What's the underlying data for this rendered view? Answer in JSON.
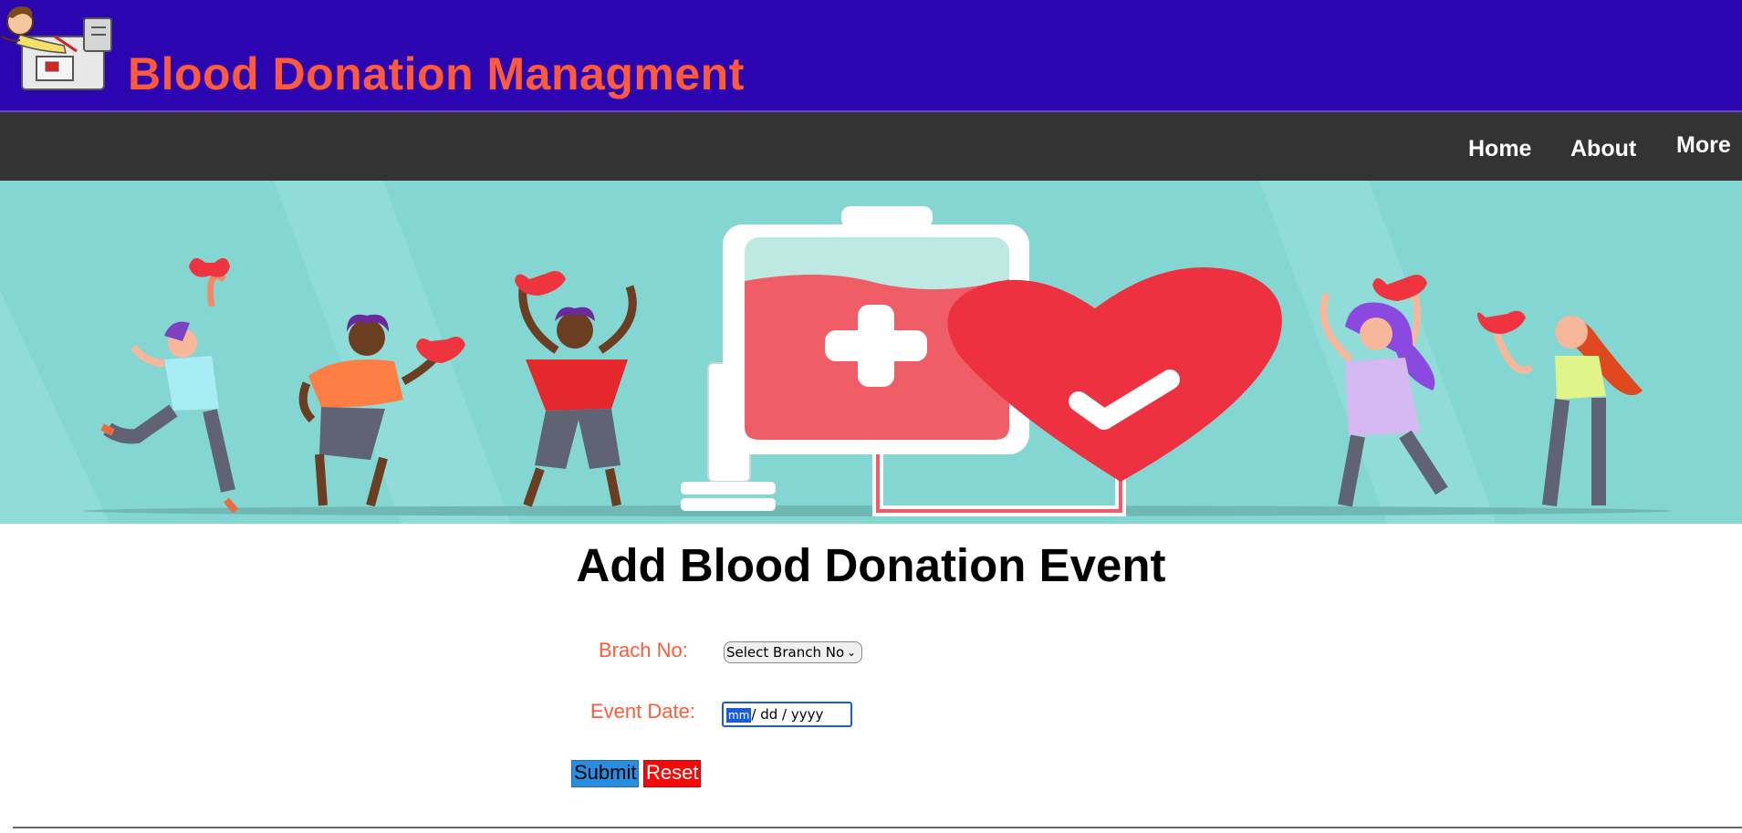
{
  "header": {
    "title": "Blood Donation Managment",
    "logo_icon": "blood-donor-cartoon-logo",
    "bg_color": "#2a05b0",
    "title_color": "#ff5a3c"
  },
  "nav": {
    "items": [
      {
        "label": "Home"
      },
      {
        "label": "About"
      },
      {
        "label": "More"
      }
    ]
  },
  "banner": {
    "illustration": "people-holding-hearts-blood-bag-syringe"
  },
  "form": {
    "title": "Add Blood Donation Event",
    "branch_label": "Brach No:",
    "branch_select_value": "Select Branch No",
    "date_label": "Event Date:",
    "date_month_placeholder": "mm",
    "date_rest_placeholder": "/ dd / yyyy",
    "submit_label": "Submit",
    "reset_label": "Reset"
  }
}
